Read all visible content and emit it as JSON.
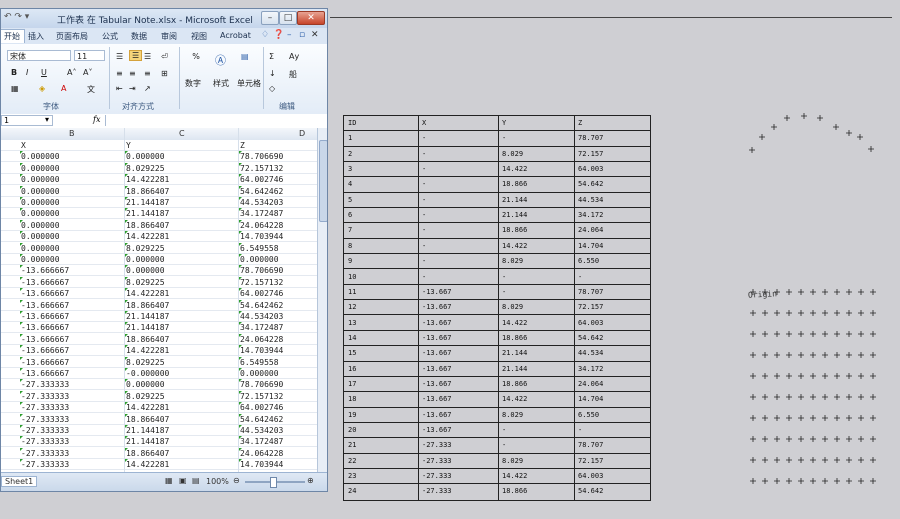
{
  "excel": {
    "title": "工作表 在 Tabular Note.xlsx - Microsoft Excel",
    "tabs": [
      "开始",
      "插入",
      "页面布局",
      "公式",
      "数据",
      "审阅",
      "视图",
      "Acrobat"
    ],
    "font_name": "宋体",
    "font_size": "11",
    "groups": {
      "font": "字体",
      "alignment": "对齐方式",
      "editing": "编辑"
    },
    "buttons": {
      "number": "数字",
      "styles": "样式",
      "cells": "单元格",
      "percent": "%",
      "sum": "Σ",
      "sort": "Aу",
      "find": "船",
      "bold": "B",
      "italic": "I",
      "underline": "U"
    },
    "namebox": "1",
    "fx": "fx",
    "columns": [
      "B",
      "C",
      "D"
    ],
    "rows": [
      [
        "X",
        "Y",
        "Z"
      ],
      [
        "0.000000",
        "0.000000",
        "78.706690"
      ],
      [
        "0.000000",
        "8.029225",
        "72.157132"
      ],
      [
        "0.000000",
        "14.422281",
        "64.002746"
      ],
      [
        "0.000000",
        "18.866407",
        "54.642462"
      ],
      [
        "0.000000",
        "21.144187",
        "44.534203"
      ],
      [
        "0.000000",
        "21.144187",
        "34.172487"
      ],
      [
        "0.000000",
        "18.866407",
        "24.064228"
      ],
      [
        "0.000000",
        "14.422281",
        "14.703944"
      ],
      [
        "0.000000",
        "8.029225",
        "6.549558"
      ],
      [
        "0.000000",
        "0.000000",
        "0.000000"
      ],
      [
        "-13.666667",
        "0.000000",
        "78.706690"
      ],
      [
        "-13.666667",
        "8.029225",
        "72.157132"
      ],
      [
        "-13.666667",
        "14.422281",
        "64.002746"
      ],
      [
        "-13.666667",
        "18.866407",
        "54.642462"
      ],
      [
        "-13.666667",
        "21.144187",
        "44.534203"
      ],
      [
        "-13.666667",
        "21.144187",
        "34.172487"
      ],
      [
        "-13.666667",
        "18.866407",
        "24.064228"
      ],
      [
        "-13.666667",
        "14.422281",
        "14.703944"
      ],
      [
        "-13.666667",
        "8.029225",
        "6.549558"
      ],
      [
        "-13.666667",
        "-0.000000",
        "0.000000"
      ],
      [
        "-27.333333",
        "0.000000",
        "78.706690"
      ],
      [
        "-27.333333",
        "8.029225",
        "72.157132"
      ],
      [
        "-27.333333",
        "14.422281",
        "64.002746"
      ],
      [
        "-27.333333",
        "18.866407",
        "54.642462"
      ],
      [
        "-27.333333",
        "21.144187",
        "44.534203"
      ],
      [
        "-27.333333",
        "21.144187",
        "34.172487"
      ],
      [
        "-27.333333",
        "18.866407",
        "24.064228"
      ],
      [
        "-27.333333",
        "14.422281",
        "14.703944"
      ]
    ],
    "sheet_tab": "Sheet1",
    "zoom": "100%"
  },
  "note": {
    "headers": [
      "ID",
      "X",
      "Y",
      "Z"
    ],
    "rows": [
      [
        "1",
        "-",
        "-",
        "78.707"
      ],
      [
        "2",
        "-",
        "8.029",
        "72.157"
      ],
      [
        "3",
        "-",
        "14.422",
        "64.003"
      ],
      [
        "4",
        "-",
        "18.866",
        "54.642"
      ],
      [
        "5",
        "-",
        "21.144",
        "44.534"
      ],
      [
        "6",
        "-",
        "21.144",
        "34.172"
      ],
      [
        "7",
        "-",
        "18.866",
        "24.064"
      ],
      [
        "8",
        "-",
        "14.422",
        "14.704"
      ],
      [
        "9",
        "-",
        "8.029",
        "6.550"
      ],
      [
        "10",
        "-",
        "-",
        "-"
      ],
      [
        "11",
        "-13.667",
        "-",
        "78.707"
      ],
      [
        "12",
        "-13.667",
        "8.029",
        "72.157"
      ],
      [
        "13",
        "-13.667",
        "14.422",
        "64.003"
      ],
      [
        "14",
        "-13.667",
        "18.866",
        "54.642"
      ],
      [
        "15",
        "-13.667",
        "21.144",
        "44.534"
      ],
      [
        "16",
        "-13.667",
        "21.144",
        "34.172"
      ],
      [
        "17",
        "-13.667",
        "18.866",
        "24.064"
      ],
      [
        "18",
        "-13.667",
        "14.422",
        "14.704"
      ],
      [
        "19",
        "-13.667",
        "8.029",
        "6.550"
      ],
      [
        "20",
        "-13.667",
        "-",
        "-"
      ],
      [
        "21",
        "-27.333",
        "-",
        "78.707"
      ],
      [
        "22",
        "-27.333",
        "8.029",
        "72.157"
      ],
      [
        "23",
        "-27.333",
        "14.422",
        "64.003"
      ],
      [
        "24",
        "-27.333",
        "18.866",
        "54.642"
      ]
    ]
  },
  "sketch": {
    "origin_label": "Origin"
  },
  "colors": {
    "green_triangle": "#2e9e2e",
    "window_blue": "#c6d6ea"
  }
}
